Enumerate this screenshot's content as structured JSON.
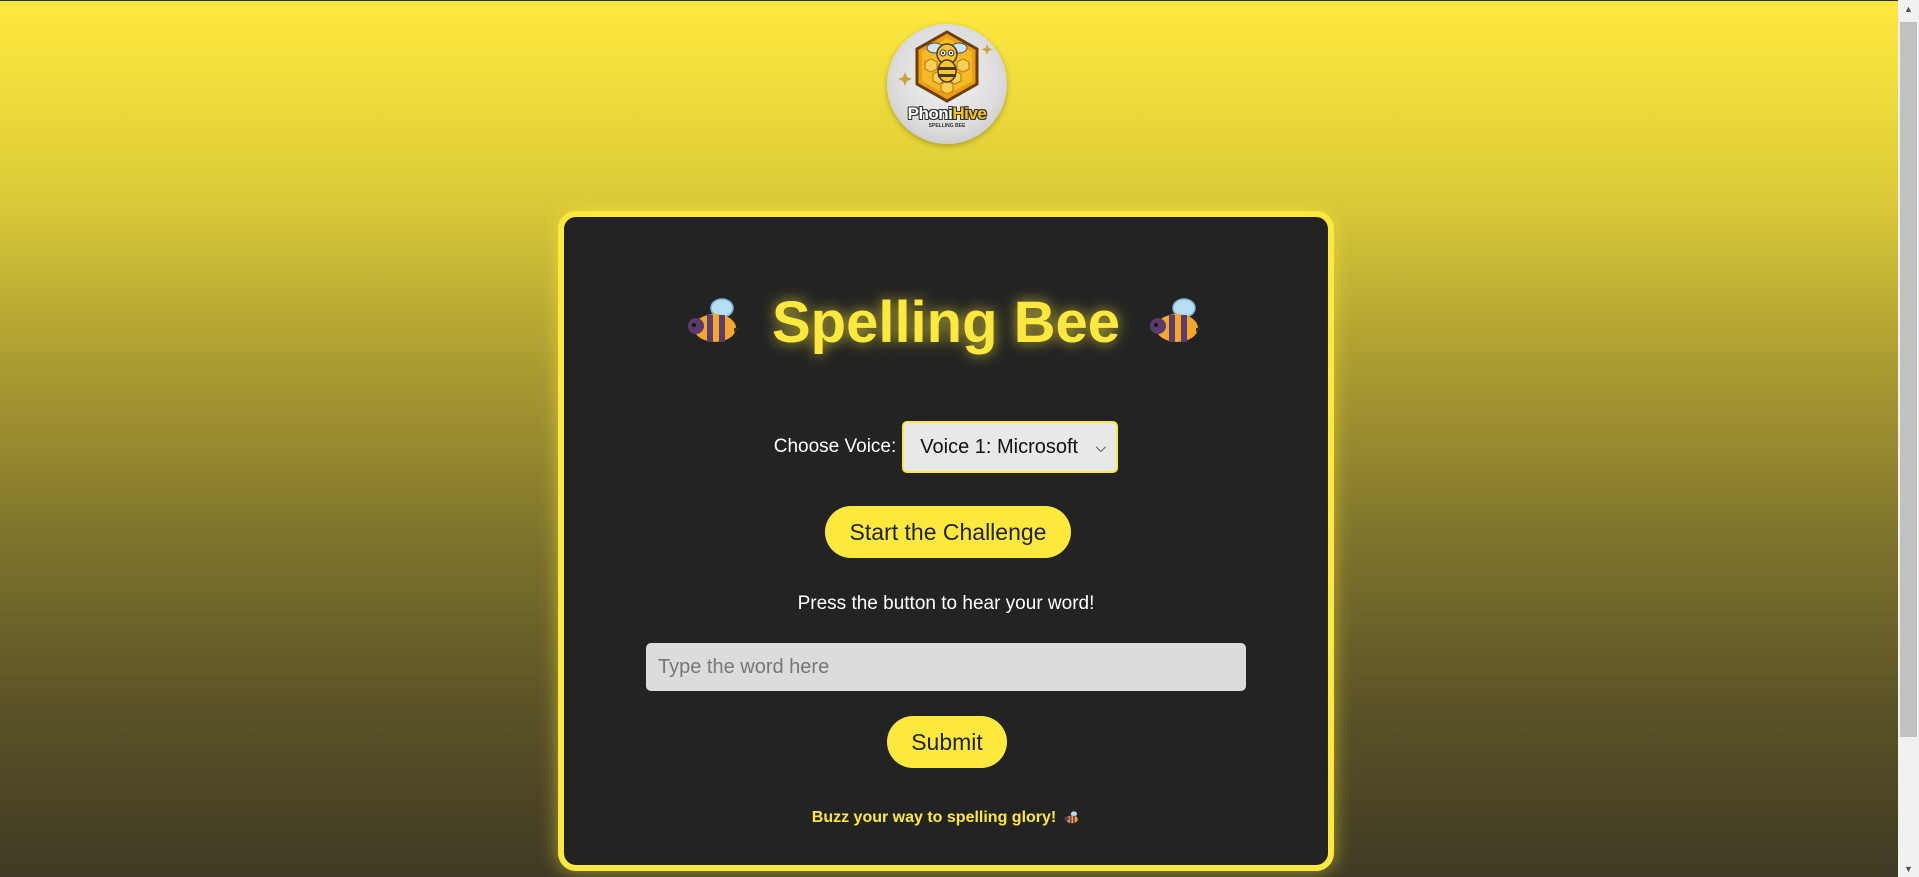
{
  "logo": {
    "name": "PhoniHive",
    "name_part1": "Phoni",
    "name_part2": "Hive",
    "tagline": "SPELLING BEE"
  },
  "game": {
    "title": "Spelling Bee",
    "title_icon": "bee-emoji",
    "voice_label": "Choose Voice:",
    "voice_selected": "Voice 1: Microsoft",
    "start_button": "Start the Challenge",
    "instruction": "Press the button to hear your word!",
    "word_placeholder": "Type the word here",
    "submit_button": "Submit",
    "footer": "Buzz your way to spelling glory!"
  },
  "colors": {
    "accent": "#fde93e",
    "card_bg": "#232323",
    "input_bg": "#dcdcdc"
  }
}
